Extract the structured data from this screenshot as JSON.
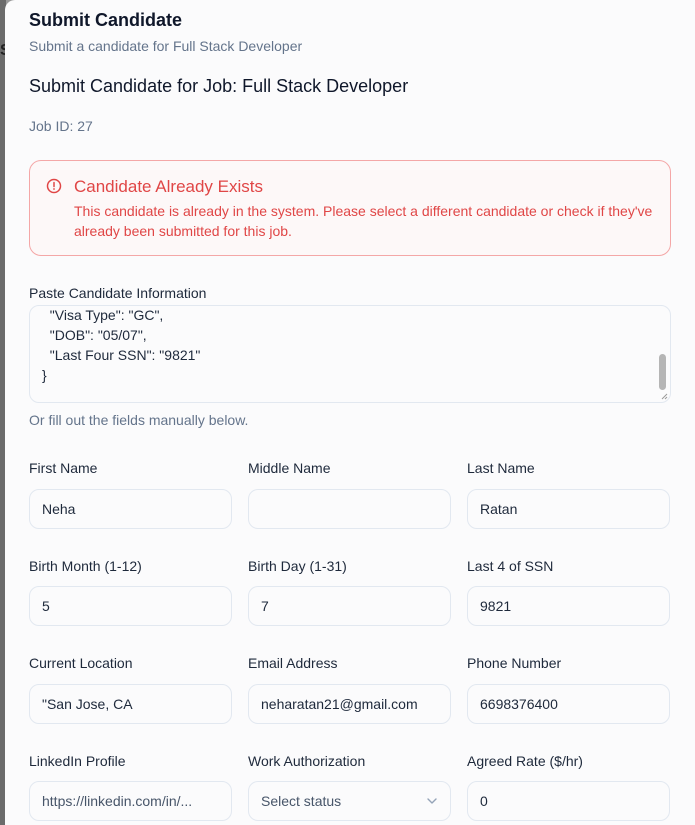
{
  "dialog": {
    "title": "Submit Candidate",
    "description": "Submit a candidate for Full Stack Developer"
  },
  "job": {
    "heading": "Submit Candidate for Job: Full Stack Developer",
    "id_text": "Job ID: 27"
  },
  "alert": {
    "icon": "alert-circle-icon",
    "title": "Candidate Already Exists",
    "message": "This candidate is already in the system. Please select a different candidate or check if they've already been submitted for this job.",
    "color": "#e04646"
  },
  "paste": {
    "label": "Paste Candidate Information",
    "lines": [
      "  \"Visa Type\": \"GC\",",
      "  \"DOB\": \"05/07\",",
      "  \"Last Four SSN\": \"9821\"",
      "}"
    ]
  },
  "hint": "Or fill out the fields manually below.",
  "fields": {
    "first_name": {
      "label": "First Name",
      "value": "Neha"
    },
    "middle_name": {
      "label": "Middle Name",
      "value": ""
    },
    "last_name": {
      "label": "Last Name",
      "value": "Ratan"
    },
    "birth_month": {
      "label": "Birth Month (1-12)",
      "value": "5"
    },
    "birth_day": {
      "label": "Birth Day (1-31)",
      "value": "7"
    },
    "ssn_last4": {
      "label": "Last 4 of SSN",
      "value": "9821"
    },
    "location": {
      "label": "Current Location",
      "value": "\"San Jose, CA"
    },
    "email": {
      "label": "Email Address",
      "value": "neharatan21@gmail.com"
    },
    "phone": {
      "label": "Phone Number",
      "value": "6698376400"
    },
    "linkedin": {
      "label": "LinkedIn Profile",
      "value": "https://linkedin.com/in/..."
    },
    "work_auth": {
      "label": "Work Authorization",
      "value": "Select status"
    },
    "rate": {
      "label": "Agreed Rate ($/hr)",
      "value": "0"
    }
  }
}
